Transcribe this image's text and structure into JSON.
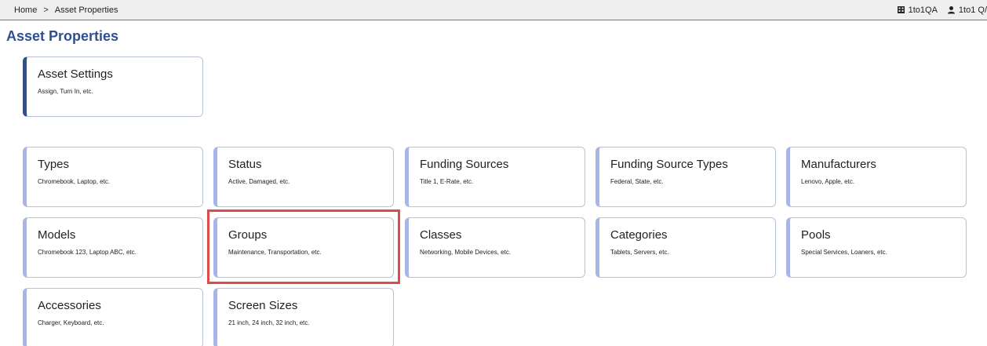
{
  "breadcrumb": {
    "home": "Home",
    "separator": ">",
    "current": "Asset Properties"
  },
  "topbar": {
    "building_label": "1to1QA",
    "building_icon": "building-icon",
    "user_label": "1to1 Q/",
    "user_icon": "user-icon"
  },
  "page_title": "Asset Properties",
  "cards": {
    "asset_settings": {
      "title": "Asset Settings",
      "desc": "Assign, Turn In, etc."
    },
    "types": {
      "title": "Types",
      "desc": "Chromebook, Laptop, etc."
    },
    "status": {
      "title": "Status",
      "desc": "Active, Damaged, etc."
    },
    "funding_sources": {
      "title": "Funding Sources",
      "desc": "Title 1, E-Rate, etc."
    },
    "funding_source_types": {
      "title": "Funding Source Types",
      "desc": "Federal, State, etc."
    },
    "manufacturers": {
      "title": "Manufacturers",
      "desc": "Lenovo, Apple, etc."
    },
    "models": {
      "title": "Models",
      "desc": "Chromebook 123, Laptop ABC, etc."
    },
    "groups": {
      "title": "Groups",
      "desc": "Maintenance, Transportation, etc."
    },
    "classes": {
      "title": "Classes",
      "desc": "Networking, Mobile Devices, etc."
    },
    "categories": {
      "title": "Categories",
      "desc": "Tablets, Servers, etc."
    },
    "pools": {
      "title": "Pools",
      "desc": "Special Services, Loaners, etc."
    },
    "accessories": {
      "title": "Accessories",
      "desc": "Charger, Keyboard, etc."
    },
    "screen_sizes": {
      "title": "Screen Sizes",
      "desc": "21 inch, 24 inch, 32 inch, etc."
    }
  },
  "colors": {
    "title": "#2f4f93",
    "accent": "#a7b6e6",
    "highlight": "#e24a4a",
    "topbar_border": "#d9534f"
  }
}
